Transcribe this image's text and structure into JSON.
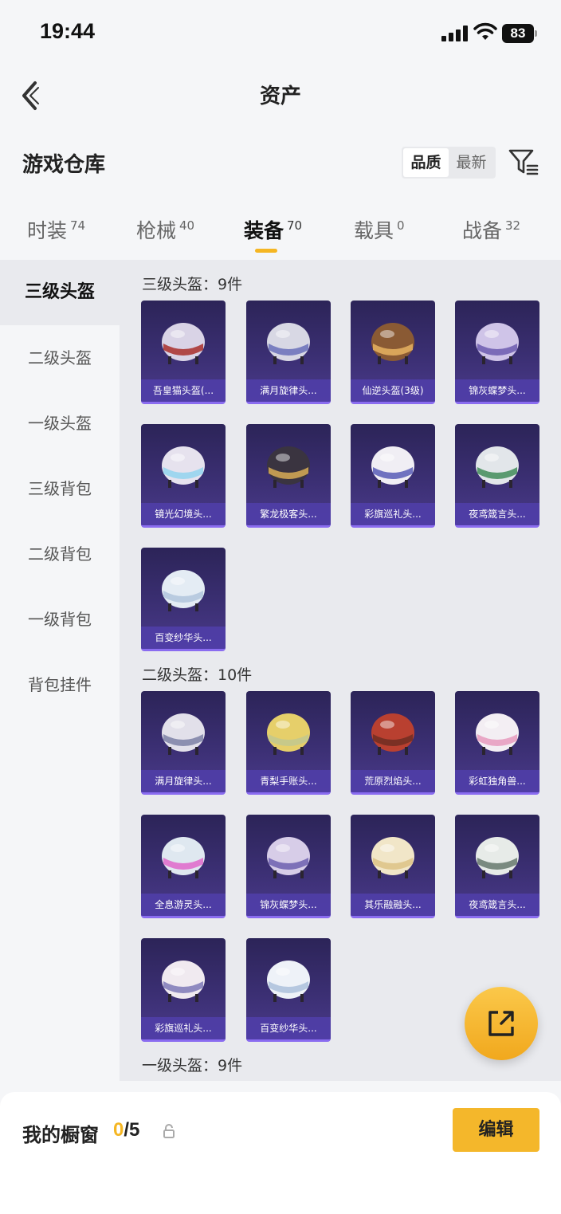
{
  "status_bar": {
    "time": "19:44",
    "battery": "83"
  },
  "nav": {
    "title": "资产"
  },
  "header": {
    "title": "游戏仓库",
    "sort_options": [
      "品质",
      "最新"
    ],
    "active_sort": "品质"
  },
  "tabs": [
    {
      "label": "时装",
      "count": "74"
    },
    {
      "label": "枪械",
      "count": "40"
    },
    {
      "label": "装备",
      "count": "70",
      "active": true
    },
    {
      "label": "载具",
      "count": "0"
    },
    {
      "label": "战备",
      "count": "32"
    }
  ],
  "sidebar": {
    "items": [
      "三级头盔",
      "二级头盔",
      "一级头盔",
      "三级背包",
      "二级背包",
      "一级背包",
      "背包挂件"
    ],
    "active": "三级头盔"
  },
  "groups": [
    {
      "title": "三级头盔：9件",
      "items": [
        "吾皇猫头盔(...",
        "满月旋律头...",
        "仙逆头盔(3级)",
        "锦灰蝶梦头...",
        "镜光幻境头...",
        "繁龙极客头...",
        "彩旗巡礼头...",
        "夜鸢箴言头...",
        "百变纱华头..."
      ]
    },
    {
      "title": "二级头盔：10件",
      "items": [
        "满月旋律头...",
        "青梨手账头...",
        "荒原烈焰头...",
        "彩虹独角兽...",
        "全息游灵头...",
        "锦灰蝶梦头...",
        "其乐融融头...",
        "夜鸢箴言头...",
        "彩旗巡礼头...",
        "百变纱华头..."
      ]
    },
    {
      "title": "一级头盔：9件",
      "items": []
    }
  ],
  "bottom": {
    "label": "我的橱窗",
    "current": "0",
    "total": "/5",
    "edit_label": "编辑"
  },
  "colors": {
    "accent": "#f5b623",
    "card_bg": "#3b2f73",
    "card_label": "#503eaa"
  }
}
